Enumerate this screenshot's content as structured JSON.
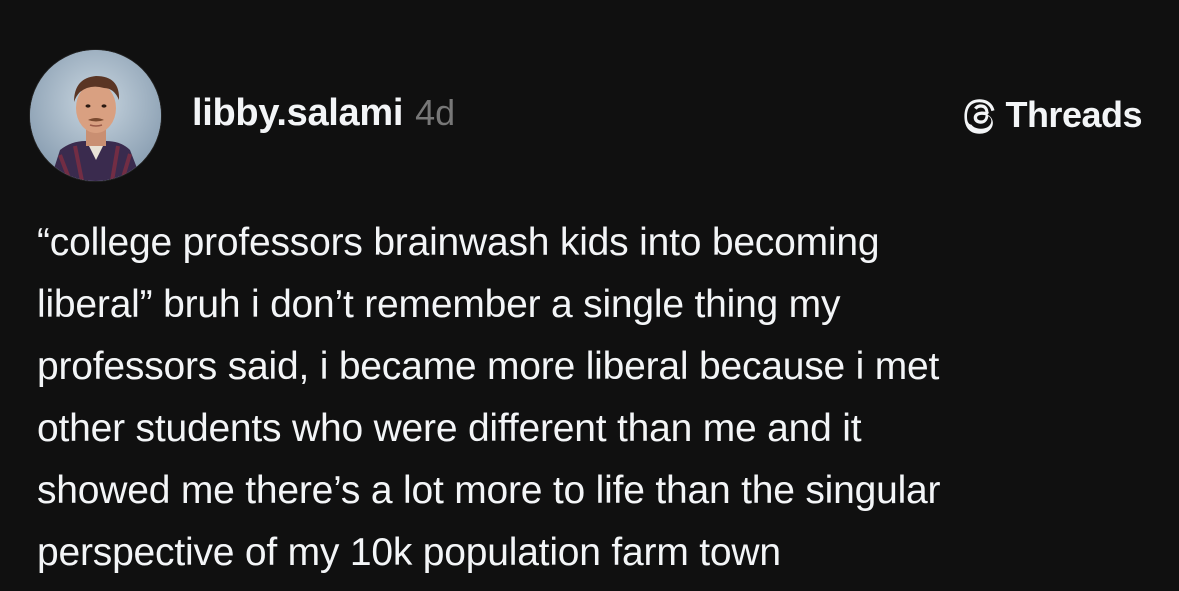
{
  "author": {
    "username": "libby.salami",
    "timestamp": "4d",
    "avatar_icon": "profile-photo-avatar"
  },
  "brand": {
    "icon": "threads-logo-icon",
    "label": "Threads"
  },
  "post": {
    "lines": [
      "“college professors brainwash kids into becoming",
      "liberal” bruh i don’t remember a single thing my",
      "professors said, i became more liberal because i met",
      "other students who were different than me and it",
      "showed me there’s a lot more to life than the singular",
      "perspective of my 10k population farm town"
    ]
  },
  "colors": {
    "background": "#101010",
    "text_primary": "#f3f5f7",
    "text_secondary": "#777777"
  }
}
